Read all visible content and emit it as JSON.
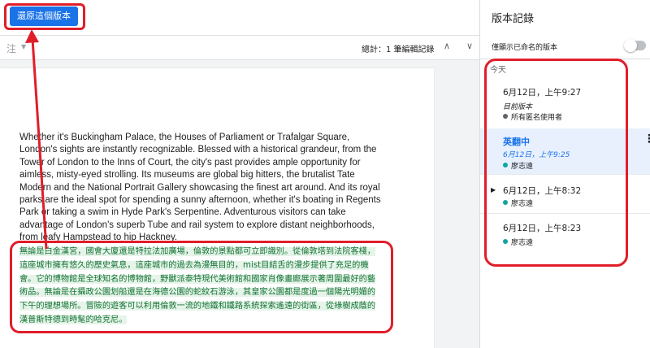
{
  "toolbar": {
    "restore_label": "還原這個版本",
    "left_label": "注",
    "total_label": "總計：1 筆編輯記錄",
    "prev_icon": "chevron-up-icon",
    "next_icon": "chevron-down-icon"
  },
  "document": {
    "english": "Whether it's Buckingham Palace, the Houses of Parliament or Trafalgar Square, London's sights are instantly recognizable. Blessed with a historical grandeur, from the Tower of London to the Inns of Court, the city's past provides ample opportunity for aimless, misty-eyed strolling. Its museums are global big hitters, the brutalist Tate Modern and the National Portrait Gallery showcasing the finest art around. And its royal parks are the ideal spot for spending a sunny afternoon, whether it's boating in Regents Park or taking a swim in Hyde Park's Serpentine. Adventurous visitors can take advantage of London's superb Tube and rail system to explore distant neighborhoods, from leafy Hampstead to hip Hackney.",
    "chinese": "無論是白金漢宮，國會大廈還是特拉法加廣場，倫敦的景點都可立即識別。從倫敦塔到法院客棧，這座城市擁有悠久的歷史氣息，這座城市的過去為漫無目的，mist目結舌的漫步提供了充足的機會。它的博物館是全球知名的博物館，野獸派泰特現代美術館和國家肖像畫廊展示著周圍最好的藝術品。無論是在攝政公園划船還是在海德公園的蛇紋石游泳，其皇家公園都是度過一個陽光明媚的下午的理想場所。冒險的遊客可以利用倫敦一流的地鐵和鐵路系統探索遙遠的街區，從綠樹成蔭的漢普斯特德到時髦的哈克尼。"
  },
  "history": {
    "title": "版本記錄",
    "named_only_label": "僅顯示已命名的版本",
    "group_label": "今天",
    "versions": [
      {
        "date": "6月12日，上午9:27",
        "name": "目前版本",
        "author": "所有匿名使用者",
        "author_color": "#5f6368"
      },
      {
        "title": "英翻中",
        "date": "6月12日，上午9:25",
        "author": "廖志遠",
        "author_color": "#12a4a0"
      },
      {
        "date": "6月12日，上午8:32",
        "author": "廖志遠",
        "author_color": "#12a4a0"
      },
      {
        "date": "6月12日，上午8:23",
        "author": "廖志遠",
        "author_color": "#12a4a0"
      }
    ]
  },
  "colors": {
    "accent": "#1a73e8",
    "annotation": "#e01e2a",
    "translated_text": "#137333",
    "translated_highlight": "#e6f4ea"
  }
}
